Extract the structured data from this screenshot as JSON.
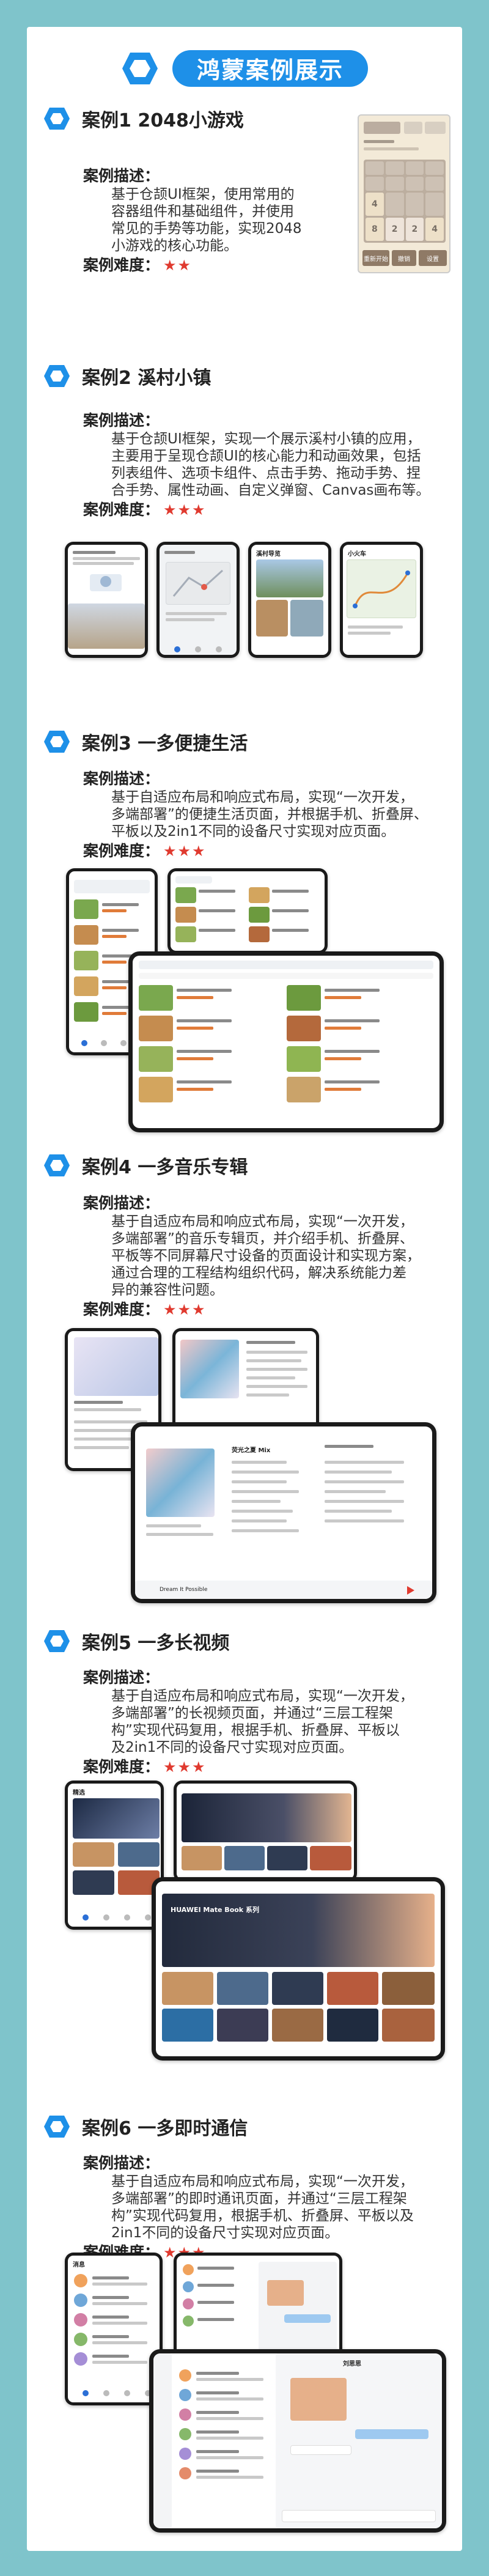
{
  "header": {
    "title": "鸿蒙案例展示"
  },
  "labels": {
    "desc": "案例描述：",
    "difficulty": "案例难度："
  },
  "cases": [
    {
      "title": "案例1 2048小游戏",
      "desc": [
        "基于仓颉UI框架，使用常用的",
        "容器组件和基础组件，并使用",
        "常见的手势等功能，实现2048",
        "小游戏的核心功能。"
      ],
      "stars": "★★"
    },
    {
      "title": "案例2 溪村小镇",
      "desc": [
        "基于仓颉UI框架，实现一个展示溪村小镇的应用，",
        "主要用于呈现仓颉UI的核心能力和动画效果，包括",
        "列表组件、选项卡组件、点击手势、拖动手势、捏",
        "合手势、属性动画、自定义弹窗、Canvas画布等。"
      ],
      "stars": "★★★"
    },
    {
      "title": "案例3 一多便捷生活",
      "desc": [
        "基于自适应布局和响应式布局，实现“一次开发，",
        "多端部署”的便捷生活页面，并根据手机、折叠屏、",
        "平板以及2in1不同的设备尺寸实现对应页面。"
      ],
      "stars": "★★★"
    },
    {
      "title": "案例4 一多音乐专辑",
      "desc": [
        "基于自适应布局和响应式布局，实现“一次开发，",
        "多端部署”的音乐专辑页，并介绍手机、折叠屏、",
        "平板等不同屏幕尺寸设备的页面设计和实现方案，",
        "通过合理的工程结构组织代码，解决系统能力差",
        "异的兼容性问题。"
      ],
      "stars": "★★★"
    },
    {
      "title": "案例5 一多长视频",
      "desc": [
        "基于自适应布局和响应式布局，实现“一次开发，",
        "多端部署”的长视频页面，并通过“三层工程架",
        "构”实现代码复用，根据手机、折叠屏、平板以",
        "及2in1不同的设备尺寸实现对应页面。"
      ],
      "stars": "★★★"
    },
    {
      "title": "案例6 一多即时通信",
      "desc": [
        "基于自适应布局和响应式布局，实现“一次开发，",
        "多端部署”的即时通讯页面，并通过“三层工程架",
        "构”实现代码复用，根据手机、折叠屏、平板以及",
        "2in1不同的设备尺寸实现对应页面。"
      ],
      "stars": "★★★"
    }
  ],
  "game2048": {
    "tiles": [
      "",
      "",
      "",
      "",
      "",
      "",
      "",
      "",
      "4",
      "",
      "",
      "",
      "8",
      "2",
      "2",
      "4"
    ],
    "buttons": [
      "重新开始",
      "撤销",
      "设置"
    ]
  },
  "village": {
    "tab_a": "溪村导览",
    "tab_b": "小火车"
  },
  "music": {
    "album": "荧光之夏 Mix",
    "artist": "Dream It Possible"
  },
  "video": {
    "tab": "精选",
    "banner": "HUAWEI Mate Book 系列"
  },
  "chat": {
    "tab": "消息",
    "contact": "刘思思"
  },
  "colors": {
    "accent": "#1e90e8",
    "star": "#e03a2f",
    "frame": "#7fc4cb"
  }
}
